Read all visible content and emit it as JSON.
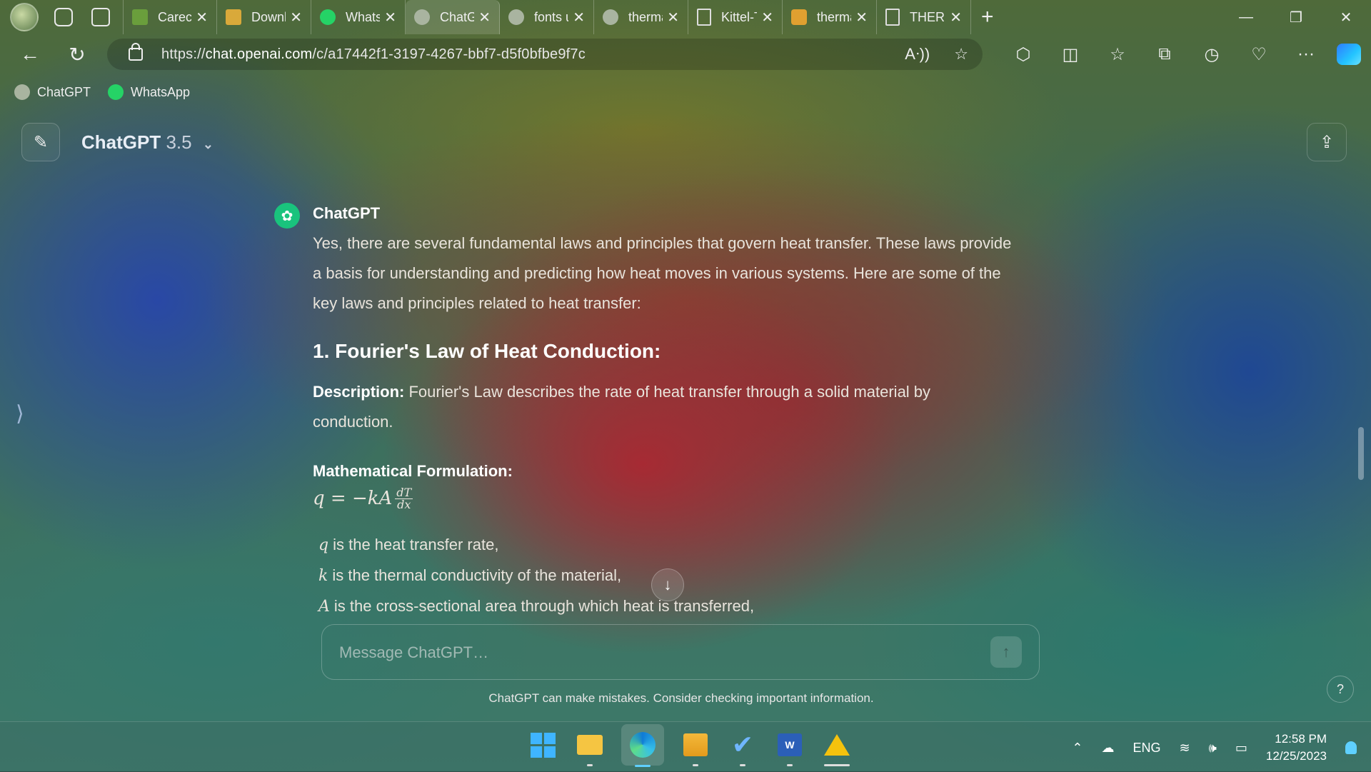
{
  "browser": {
    "tabs": [
      {
        "title": "Carecon",
        "fav_color": "#6a9e3c"
      },
      {
        "title": "Downlo",
        "fav_color": "#d9a93a"
      },
      {
        "title": "WhatsA",
        "fav_color": "#25d366"
      },
      {
        "title": "ChatGP",
        "fav_color": "#a9b4a0",
        "active": true
      },
      {
        "title": "fonts u",
        "fav_color": "#a9b4a0"
      },
      {
        "title": "therma",
        "fav_color": "#a9b4a0"
      },
      {
        "title": "Kittel-T",
        "fav_color": "#dddddd"
      },
      {
        "title": "therma",
        "fav_color": "#e0a030"
      },
      {
        "title": "THERM",
        "fav_color": "#dddddd"
      }
    ],
    "new_tab": "+",
    "url_prefix": "https://",
    "url_domain": "chat.openai.com",
    "url_path": "/c/a17442f1-3197-4267-bbf7-d5f0bfbe9f7c",
    "favorites": [
      {
        "label": "ChatGPT",
        "color": "#a9b4a0"
      },
      {
        "label": "WhatsApp",
        "color": "#25d366"
      }
    ]
  },
  "chat": {
    "model_name": "ChatGPT",
    "model_version": "3.5",
    "author": "ChatGPT",
    "intro": "Yes, there are several fundamental laws and principles that govern heat transfer. These laws provide a basis for understanding and predicting how heat moves in various systems. Here are some of the key laws and principles related to heat transfer:",
    "section_heading": "1. Fourier's Law of Heat Conduction:",
    "desc_label": "Description:",
    "desc_text": " Fourier's Law describes the rate of heat transfer through a solid material by conduction.",
    "math_label": "Mathematical Formulation:",
    "formula_lhs": "q = −kA",
    "formula_num": "dT",
    "formula_den": "dx",
    "bullets": [
      {
        "var": "q",
        "text": "is the heat transfer rate,"
      },
      {
        "var": "k",
        "text": "is the thermal conductivity of the material,"
      },
      {
        "var": "A",
        "text": "is the cross-sectional area through which heat is transferred,"
      }
    ],
    "composer_placeholder": "Message ChatGPT…",
    "disclaimer": "ChatGPT can make mistakes. Consider checking important information.",
    "help": "?"
  },
  "taskbar": {
    "language": "ENG",
    "time": "12:58 PM",
    "date": "12/25/2023"
  }
}
